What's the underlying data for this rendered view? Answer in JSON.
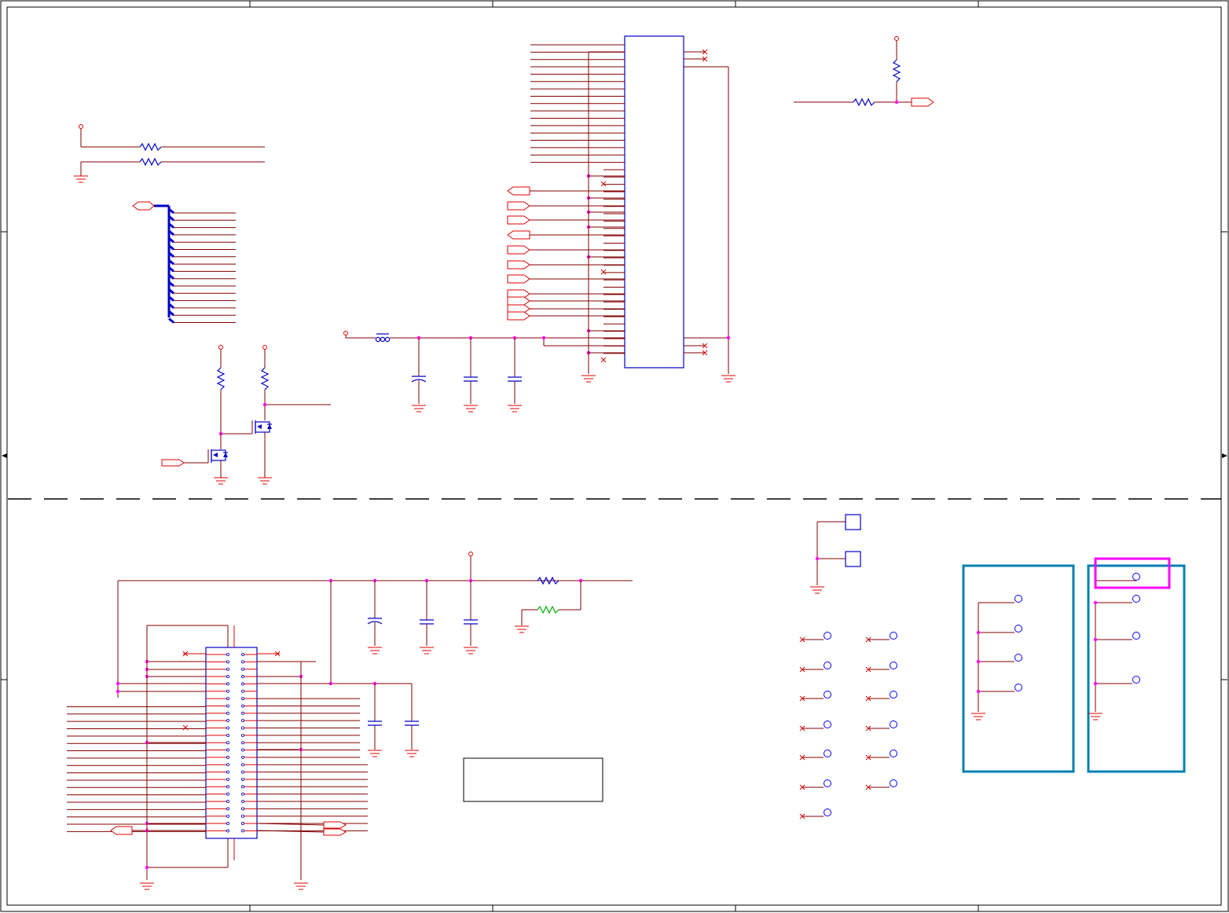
{
  "sheet": {
    "title": "",
    "colors": {
      "wire": "#800000",
      "component": "#0000c8",
      "net_label": "#e00000",
      "junction": "#ff00ff",
      "highlight_teal": "#0080b0",
      "highlight_magenta": "#ff00ff",
      "ferrite": "#00b000"
    },
    "regions": [
      "upper-schematic-section",
      "lower-schematic-section"
    ],
    "groups": [
      "test-point-group-left",
      "test-point-group-right"
    ],
    "highlighted_net": "top-test-point-right-group",
    "text_box": ""
  }
}
